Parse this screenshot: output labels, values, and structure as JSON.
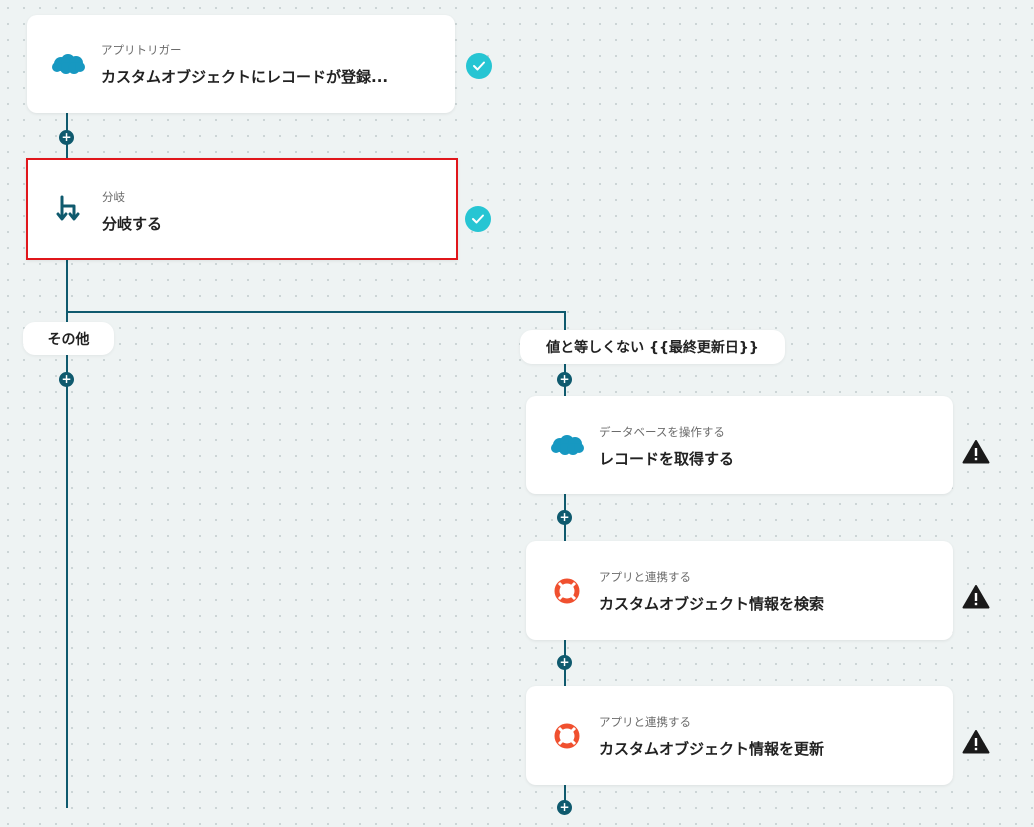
{
  "colors": {
    "connector": "#0f5a6e",
    "check": "#26c5d3",
    "selected_border": "#e0161b"
  },
  "steps": [
    {
      "sub": "アプリトリガー",
      "title": "カスタムオブジェクトにレコードが登録...",
      "icon": "salesforce-icon",
      "status": "done"
    },
    {
      "sub": "分岐",
      "title": "分岐する",
      "icon": "branch-icon",
      "status": "done"
    }
  ],
  "branches": {
    "left_label": "その他",
    "right_label": "値と等しくない {{最終更新日}}"
  },
  "right_steps": [
    {
      "sub": "データベースを操作する",
      "title": "レコードを取得する",
      "icon": "salesforce-icon",
      "status": "warning"
    },
    {
      "sub": "アプリと連携する",
      "title": "カスタムオブジェクト情報を検索",
      "icon": "lifebuoy-icon",
      "status": "warning"
    },
    {
      "sub": "アプリと連携する",
      "title": "カスタムオブジェクト情報を更新",
      "icon": "lifebuoy-icon",
      "status": "warning"
    }
  ],
  "add_symbol": "+"
}
